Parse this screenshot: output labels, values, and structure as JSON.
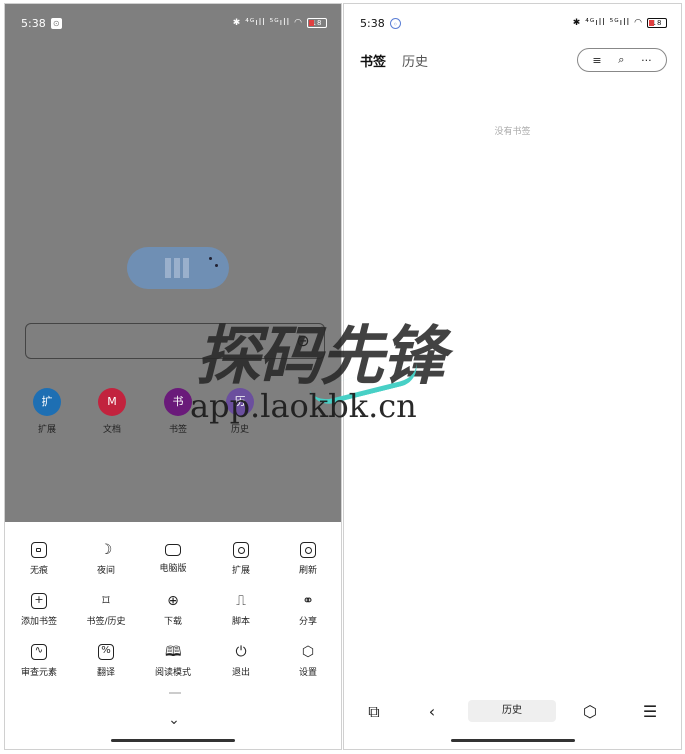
{
  "left": {
    "status": {
      "time": "5:38",
      "signal_text": "⁴ᴳıll ⁵ᴳıll",
      "battery": "18"
    },
    "quick_links": [
      {
        "label": "扩展",
        "glyph": "扩",
        "color": "#1e6fb3"
      },
      {
        "label": "文档",
        "glyph": "M",
        "color": "#c2233e"
      },
      {
        "label": "书签",
        "glyph": "书",
        "color": "#6a1a7a"
      },
      {
        "label": "历史",
        "glyph": "历",
        "color": "#6b4f9e"
      }
    ],
    "menu": [
      {
        "label": "无痕",
        "icon": "lock-icon"
      },
      {
        "label": "夜间",
        "icon": "moon-icon"
      },
      {
        "label": "电脑版",
        "icon": "monitor-icon"
      },
      {
        "label": "扩展",
        "icon": "extension-icon"
      },
      {
        "label": "刷新",
        "icon": "refresh-icon"
      },
      {
        "label": "添加书签",
        "icon": "add-bookmark-icon"
      },
      {
        "label": "书签/历史",
        "icon": "bookmark-icon"
      },
      {
        "label": "下载",
        "icon": "download-icon"
      },
      {
        "label": "脚本",
        "icon": "script-icon"
      },
      {
        "label": "分享",
        "icon": "share-icon"
      },
      {
        "label": "审查元素",
        "icon": "inspect-icon"
      },
      {
        "label": "翻译",
        "icon": "translate-icon"
      },
      {
        "label": "阅读模式",
        "icon": "reader-icon"
      },
      {
        "label": "退出",
        "icon": "power-icon"
      },
      {
        "label": "设置",
        "icon": "settings-icon"
      }
    ]
  },
  "right": {
    "status": {
      "time": "5:38",
      "signal_text": "⁴ᴳıll ⁵ᴳıll",
      "battery": "18"
    },
    "tabs": {
      "bookmarks": "书签",
      "history": "历史"
    },
    "empty_text": "没有书签",
    "bottom_history": "历史"
  },
  "watermark": {
    "title": "探码先锋",
    "url": "app.laokbk.cn"
  }
}
